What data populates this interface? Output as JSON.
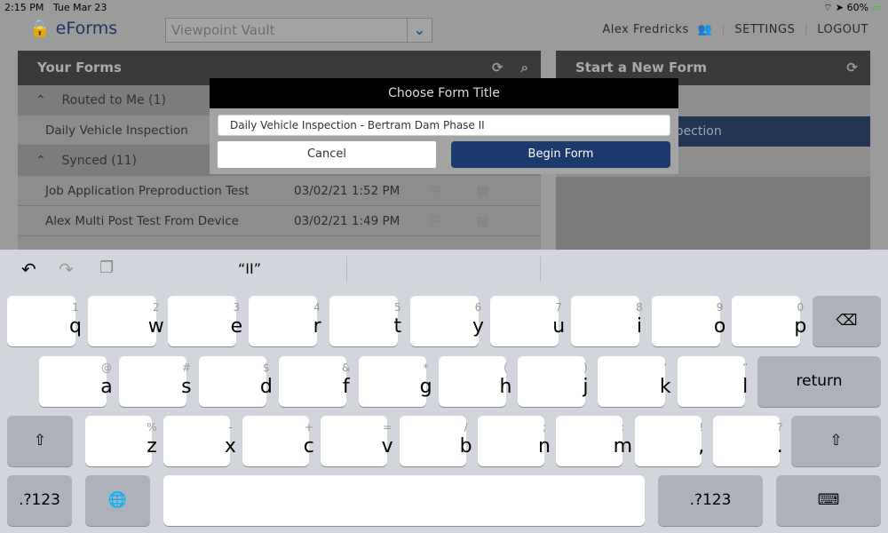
{
  "status": {
    "time": "2:15 PM",
    "date": "Tue Mar 23",
    "battery": "60%"
  },
  "header": {
    "app_name": "eForms",
    "vault": "Viewpoint Vault",
    "user": "Alex Fredricks",
    "settings": "SETTINGS",
    "logout": "LOGOUT"
  },
  "your_forms": {
    "title": "Your Forms",
    "groups": [
      {
        "label": "Routed to Me (1)",
        "rows": [
          {
            "name": "Daily Vehicle Inspection",
            "date": ""
          }
        ]
      },
      {
        "label": "Synced (11)",
        "rows": [
          {
            "name": "Job Application Preproduction Test",
            "date": "03/02/21 1:52 PM"
          },
          {
            "name": "Alex Multi Post Test From Device",
            "date": "03/02/21 1:49 PM"
          }
        ]
      }
    ]
  },
  "new_form": {
    "title": "Start a New Form",
    "selected_item": "Daily Vehicle Inspection"
  },
  "dialog": {
    "title": "Choose Form Title",
    "value": "Daily Vehicle Inspection - Bertram Dam Phase II",
    "cancel": "Cancel",
    "begin": "Begin Form",
    "accent": "#1b3a6e"
  },
  "keyboard": {
    "suggestion": "“II”",
    "row1": [
      [
        "1",
        "q"
      ],
      [
        "2",
        "w"
      ],
      [
        "3",
        "e"
      ],
      [
        "4",
        "r"
      ],
      [
        "5",
        "t"
      ],
      [
        "6",
        "y"
      ],
      [
        "7",
        "u"
      ],
      [
        "8",
        "i"
      ],
      [
        "9",
        "o"
      ],
      [
        "0",
        "p"
      ]
    ],
    "row2": [
      [
        "@",
        "a"
      ],
      [
        "#",
        "s"
      ],
      [
        "$",
        "d"
      ],
      [
        "&",
        "f"
      ],
      [
        "*",
        "g"
      ],
      [
        "(",
        "h"
      ],
      [
        ")",
        "j"
      ],
      [
        "’",
        "k"
      ],
      [
        "”",
        "l"
      ]
    ],
    "row3": [
      [
        "%",
        "z"
      ],
      [
        "-",
        "x"
      ],
      [
        "+",
        "c"
      ],
      [
        "=",
        "v"
      ],
      [
        "/",
        "b"
      ],
      [
        ";",
        "n"
      ],
      [
        ":",
        "m"
      ],
      [
        "!",
        ","
      ],
      [
        "?",
        "."
      ]
    ],
    "return": "return",
    "numbers": ".?123"
  }
}
